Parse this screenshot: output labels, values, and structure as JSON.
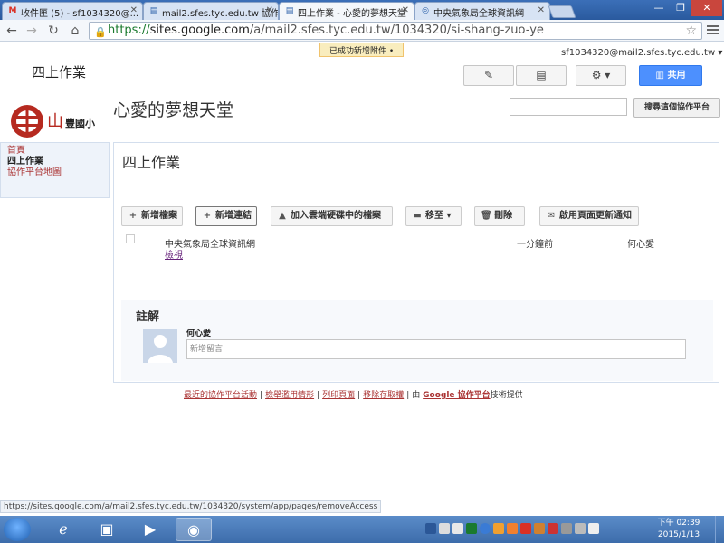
{
  "browser": {
    "tabs": [
      {
        "label": "收件匣 (5) - sf1034320@..."
      },
      {
        "label": "mail2.sfes.tyc.edu.tw 協作"
      },
      {
        "label": "四上作業 - 心愛的夢想天堂"
      },
      {
        "label": "中央氣象局全球資訊網"
      }
    ],
    "url_scheme": "https://",
    "url_host": "sites.google.com",
    "url_path": "/a/mail2.sfes.tyc.edu.tw/1034320/si-shang-zuo-ye",
    "status_url": "https://sites.google.com/a/mail2.sfes.tyc.edu.tw/1034320/system/app/pages/removeAccess"
  },
  "header": {
    "notice": "已成功新增附件 •",
    "user_email": "sf1034320@mail2.sfes.tyc.edu.tw ▾",
    "page_title": "四上作業",
    "share_label": "共用"
  },
  "site": {
    "logo_char": "山",
    "logo_text": "豐國小",
    "title": "心愛的夢想天堂",
    "search_button": "搜尋這個協作平台"
  },
  "sidebar": {
    "items": [
      {
        "label": "首頁"
      },
      {
        "label": "四上作業"
      },
      {
        "label": "協作平台地圖"
      }
    ]
  },
  "main": {
    "title": "四上作業",
    "actions": {
      "add_file": "新增檔案",
      "add_link": "新增連結",
      "add_drive": "加入雲端硬碟中的檔案",
      "move": "移至",
      "delete": "刪除",
      "notify": "啟用頁面更新通知"
    },
    "file": {
      "name": "中央氣象局全球資訊網",
      "view": "檢視",
      "time": "一分鐘前",
      "user": "何心愛"
    },
    "comments": {
      "title": "註解",
      "user": "何心愛",
      "placeholder": "新增留言"
    }
  },
  "footer": {
    "recent": "最近的協作平台活動",
    "report": "檢舉濫用情形",
    "print": "列印頁面",
    "remove": "移除存取權",
    "by": "由",
    "powered": "Google 協作平台",
    "tail": "技術提供"
  },
  "taskbar": {
    "time": "下午 02:39",
    "date": "2015/1/13"
  }
}
